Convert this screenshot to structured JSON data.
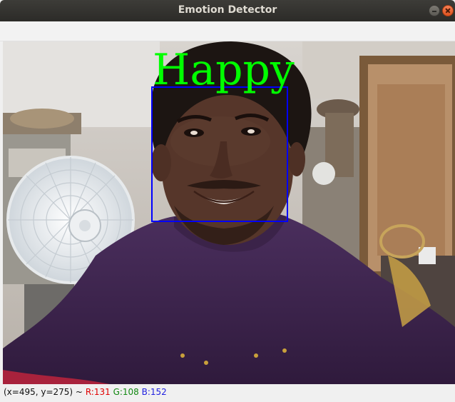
{
  "window": {
    "title": "Emotion Detector"
  },
  "detection": {
    "label": "Happy",
    "label_color": "#00ff00",
    "box_color": "#0000ff"
  },
  "status_bar": {
    "coords": "(x=495, y=275) ~",
    "r": "R:131",
    "g": "G:108",
    "b": "B:152"
  }
}
